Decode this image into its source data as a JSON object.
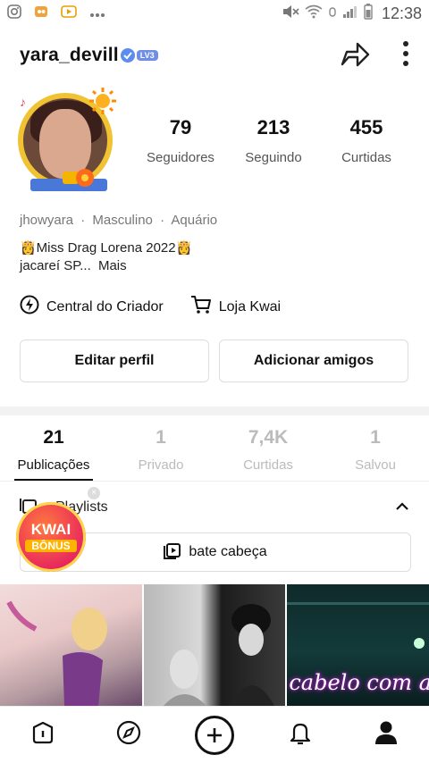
{
  "status_bar": {
    "time": "12:38"
  },
  "header": {
    "username": "yara_devill",
    "level": "LV3"
  },
  "profile": {
    "stats": [
      {
        "value": "79",
        "label": "Seguidores"
      },
      {
        "value": "213",
        "label": "Seguindo"
      },
      {
        "value": "455",
        "label": "Curtidas"
      }
    ],
    "info": {
      "name": "jhowyara",
      "gender": "Masculino",
      "sign": "Aquário",
      "separator": "·"
    },
    "bio_line1": "👸Miss Drag Lorena 2022👸",
    "bio_line2": "jacareí SP...",
    "bio_more": "Mais"
  },
  "links": {
    "creator_center": "Central do Criador",
    "shop": "Loja Kwai"
  },
  "buttons": {
    "edit_profile": "Editar perfil",
    "add_friends": "Adicionar amigos"
  },
  "tabs": [
    {
      "count": "21",
      "label": "Publicações",
      "active": true
    },
    {
      "count": "1",
      "label": "Privado",
      "active": false
    },
    {
      "count": "7,4K",
      "label": "Curtidas",
      "active": false
    },
    {
      "count": "1",
      "label": "Salvou",
      "active": false
    }
  ],
  "playlists": {
    "title": "Playlists",
    "item": "bate cabeça"
  },
  "kwai_bonus": {
    "line1": "KWAI",
    "line2": "BÔNUS"
  },
  "thumbnails": {
    "caption3": "cabelo com a m"
  },
  "icons": {
    "share": "share-icon",
    "more": "more-vertical-icon",
    "home": "home-icon",
    "discover": "compass-icon",
    "create": "plus-circle-icon",
    "notifications": "bell-icon",
    "profile": "profile-icon"
  },
  "colors": {
    "accent_gold": "#f1c232",
    "badge_blue": "#6f8ee8",
    "kwai_red": "#e8265e"
  }
}
